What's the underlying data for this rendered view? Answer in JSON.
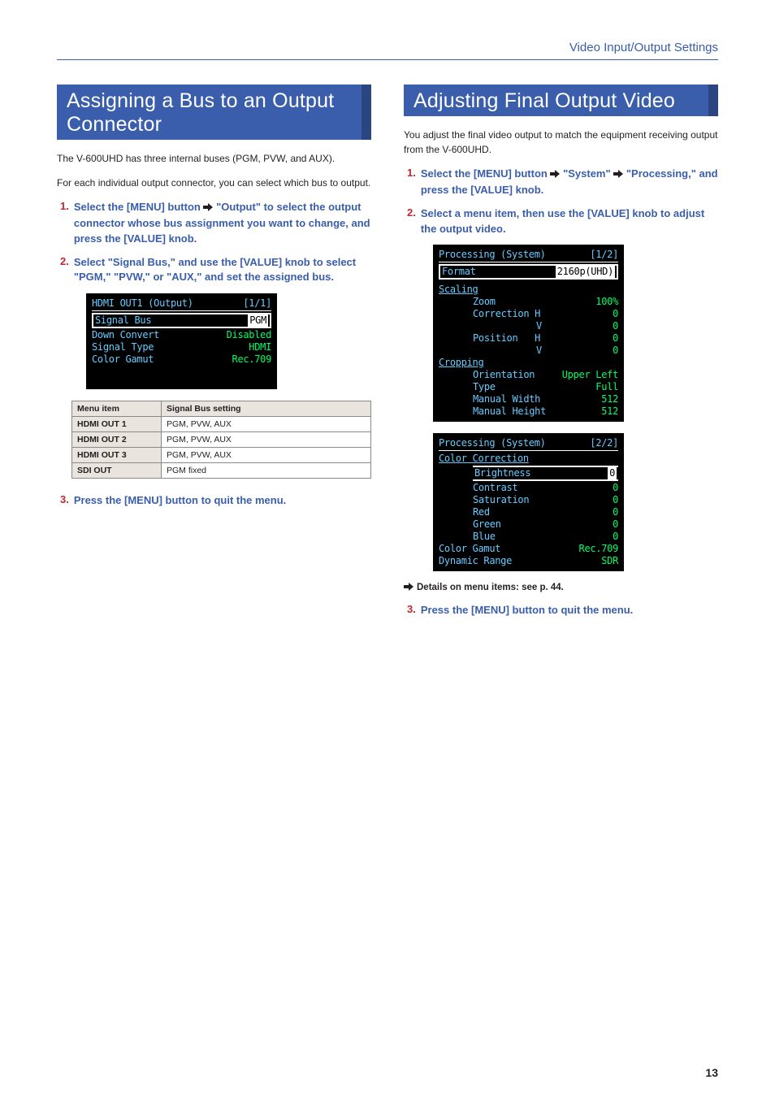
{
  "header": {
    "section_label": "Video Input/Output Settings"
  },
  "left": {
    "title": "Assigning a Bus to an Output Connector",
    "intro1": "The V-600UHD has three internal buses (PGM, PVW, and AUX).",
    "intro2": "For each individual output connector, you can select which bus to output.",
    "step1_num": "1.",
    "step1_a": "Select the [MENU] button ",
    "step1_b": " \"Output\" to select the output connector whose bus assignment you want to change, and press the [VALUE] knob.",
    "step2_num": "2.",
    "step2": "Select \"Signal Bus,\" and use the [VALUE] knob to select \"PGM,\" \"PVW,\" or \"AUX,\" and set the assigned bus.",
    "screen1": {
      "title_l": "HDMI OUT1 (Output)",
      "title_r": "[1/1]",
      "r1_l": "Signal Bus",
      "r1_r": "PGM",
      "r2_l": "Down Convert",
      "r2_r": "Disabled",
      "r3_l": "Signal Type",
      "r3_r": "HDMI",
      "r4_l": "Color Gamut",
      "r4_r": "Rec.709"
    },
    "table": {
      "h1": "Menu item",
      "h2": "Signal Bus setting",
      "rows": [
        {
          "c1": "HDMI OUT 1",
          "c2": "PGM, PVW, AUX"
        },
        {
          "c1": "HDMI OUT 2",
          "c2": "PGM, PVW, AUX"
        },
        {
          "c1": "HDMI OUT 3",
          "c2": "PGM, PVW, AUX"
        },
        {
          "c1": "SDI OUT",
          "c2": "PGM fixed"
        }
      ]
    },
    "step3_num": "3.",
    "step3": "Press the [MENU] button to quit the menu."
  },
  "right": {
    "title": "Adjusting Final Output Video",
    "intro": "You adjust the final video output to match the equipment receiving output from the V-600UHD.",
    "step1_num": "1.",
    "step1_a": "Select the [MENU] button ",
    "step1_b": " \"System\" ",
    "step1_c": " \"Processing,\" and press the [VALUE] knob.",
    "step2_num": "2.",
    "step2": "Select a menu item, then use the [VALUE] knob to adjust the output video.",
    "screenA": {
      "title_l": "Processing (System)",
      "title_r": "[1/2]",
      "format_l": "Format",
      "format_r": "2160p(UHD)",
      "scaling_h": "Scaling",
      "zoom_l": "Zoom",
      "zoom_r": "100%",
      "corrH_l": "Correction H",
      "corrH_r": "0",
      "corrV_l": "V",
      "corrV_r": "0",
      "posH_l": "Position   H",
      "posH_r": "0",
      "posV_l": "V",
      "posV_r": "0",
      "cropping_h": "Cropping",
      "orient_l": "Orientation",
      "orient_r": "Upper Left",
      "type_l": "Type",
      "type_r": "Full",
      "mw_l": "Manual Width",
      "mw_r": "512",
      "mh_l": "Manual Height",
      "mh_r": "512"
    },
    "screenB": {
      "title_l": "Processing (System)",
      "title_r": "[2/2]",
      "cc_h": "Color Correction",
      "bright_l": "Brightness",
      "bright_r": "0",
      "contrast_l": "Contrast",
      "contrast_r": "0",
      "sat_l": "Saturation",
      "sat_r": "0",
      "red_l": "Red",
      "red_r": "0",
      "green_l": "Green",
      "green_r": "0",
      "blue_l": "Blue",
      "blue_r": "0",
      "cg_l": "Color Gamut",
      "cg_r": "Rec.709",
      "dr_l": "Dynamic Range",
      "dr_r": "SDR"
    },
    "note": "Details on menu items: see p. 44.",
    "step3_num": "3.",
    "step3": "Press the [MENU] button to quit the menu."
  },
  "page_number": "13"
}
